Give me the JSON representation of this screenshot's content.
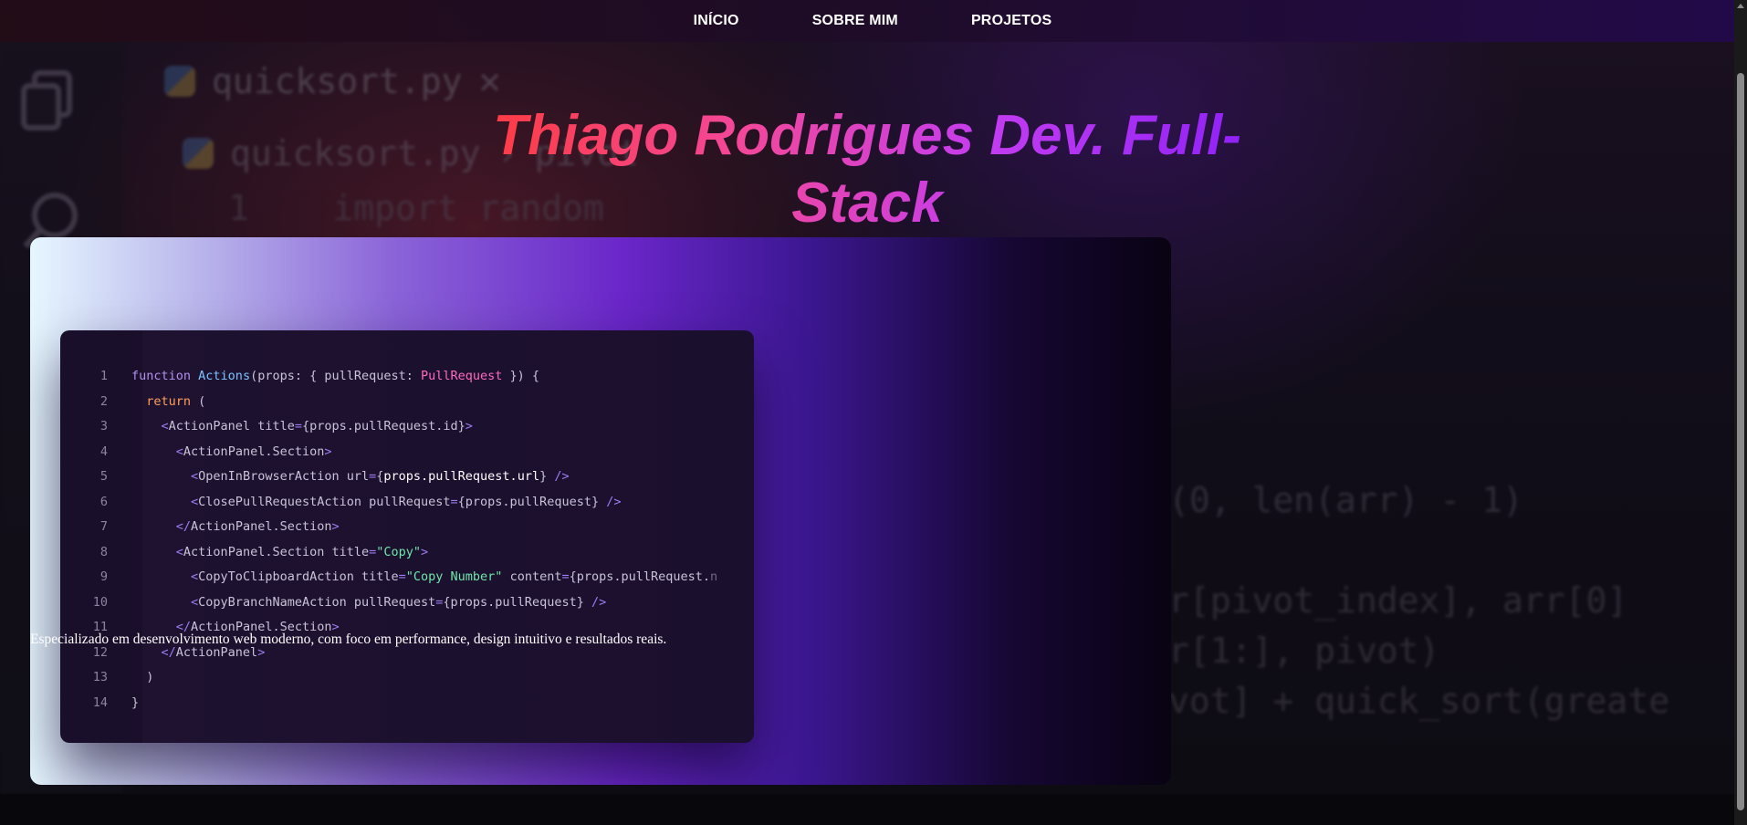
{
  "nav": {
    "items": [
      {
        "label": "INÍCIO"
      },
      {
        "label": "SOBRE MIM"
      },
      {
        "label": "PROJETOS"
      }
    ]
  },
  "hero": {
    "title": "Thiago Rodrigues Dev. Full-Stack",
    "tagline": "Especializado em desenvolvimento web moderno, com foco em performance, design intuitivo e resultados reais."
  },
  "background_code": {
    "tab_name": "quicksort.py",
    "tab_name_secondary": "quicksort.py",
    "breadcrumb_fragment": "pivot",
    "line_1": "1    import random",
    "line_a": "(0, len(arr) - 1)",
    "line_b": "r[pivot_index], arr[0]",
    "line_c": "r[1:], pivot)",
    "line_d": "vot] + quick_sort(greate"
  },
  "code_sample": {
    "line_numbers": [
      "1",
      "2",
      "3",
      "4",
      "5",
      "6",
      "7",
      "8",
      "9",
      "10",
      "11",
      "12",
      "13",
      "14"
    ],
    "colors": {
      "keyword": "#b392f0",
      "function": "#7cc4ff",
      "type": "#ff6ac1",
      "return": "#ff9f5a",
      "tag": "#9d7cf2",
      "string": "#6ee7a8"
    }
  },
  "theme": {
    "title_gradient": [
      "#ff3b3b",
      "#f2479c",
      "#c33cf0",
      "#8b1ff7"
    ],
    "nav_text": "#ffffff"
  }
}
